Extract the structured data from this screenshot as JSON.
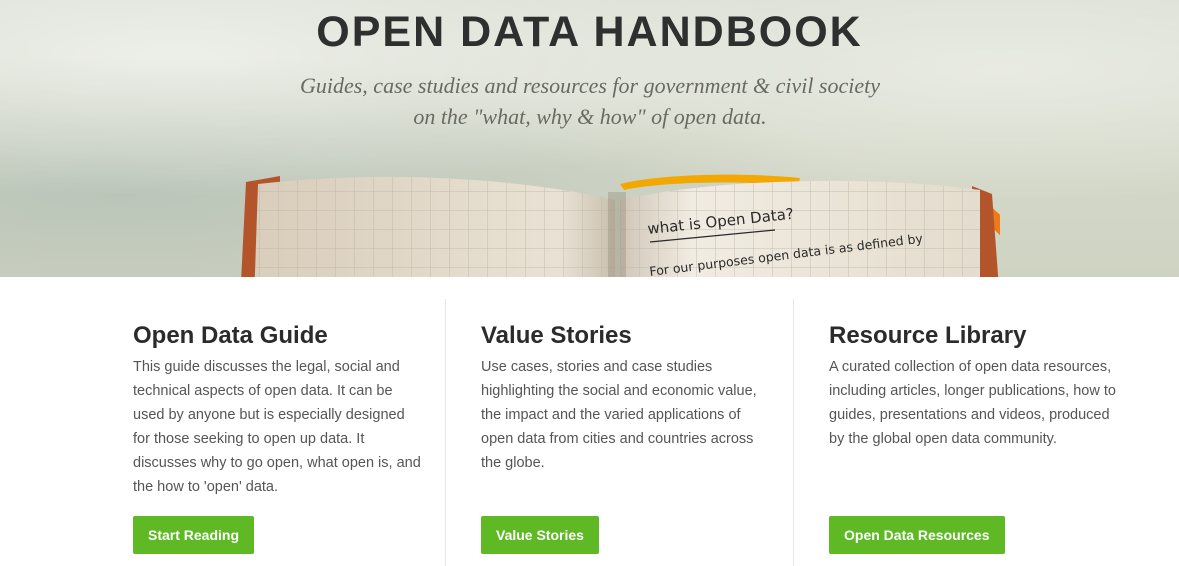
{
  "hero": {
    "title": "OPEN DATA HANDBOOK",
    "subtitle_line1": "Guides, case studies and resources for government & civil society",
    "subtitle_line2": "on the \"what, why & how\" of open data.",
    "notebook_heading": "what is Open Data?",
    "notebook_text": "For our purposes open data is as defined by"
  },
  "columns": [
    {
      "title": "Open Data Guide",
      "text": "This guide discusses the legal, social and technical aspects of open data. It can be used by anyone but is especially designed for those seeking to open up data. It discusses why to go open, what open is, and the how to 'open' data.",
      "button": "Start Reading"
    },
    {
      "title": "Value Stories",
      "text": "Use cases, stories and case studies highlighting the social and economic value, the impact and the varied applications of open data from cities and countries across the globe.",
      "button": "Value Stories"
    },
    {
      "title": "Resource Library",
      "text": "A curated collection of open data resources, including articles, longer publications, how to guides, presentations and videos, produced by the global open data community.",
      "button": "Open Data Resources"
    }
  ],
  "colors": {
    "button_green": "#5fb925",
    "ribbon_orange": "#ef7a1a"
  }
}
